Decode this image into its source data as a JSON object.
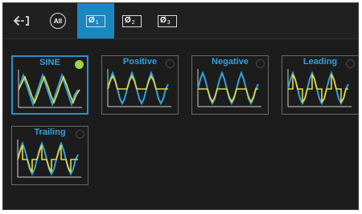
{
  "colors": {
    "accent": "#1a87c2",
    "title": "#2ea3e0",
    "wave_primary": "#2ea3e0",
    "wave_secondary": "#e8d83a",
    "selected_indicator": "#9bd64a"
  },
  "toolbar": {
    "back_icon": "back-arrow-icon",
    "tabs": [
      {
        "label": "All",
        "active": false
      },
      {
        "phi": "Ø",
        "num": "1",
        "active": true
      },
      {
        "phi": "Ø",
        "num": "2",
        "active": false
      },
      {
        "phi": "Ø",
        "num": "3",
        "active": false
      }
    ]
  },
  "waveforms": [
    {
      "title": "SINE",
      "selected": true
    },
    {
      "title": "Positive",
      "selected": false
    },
    {
      "title": "Negative",
      "selected": false
    },
    {
      "title": "Leading",
      "selected": false
    },
    {
      "title": "Trailing",
      "selected": false
    }
  ]
}
